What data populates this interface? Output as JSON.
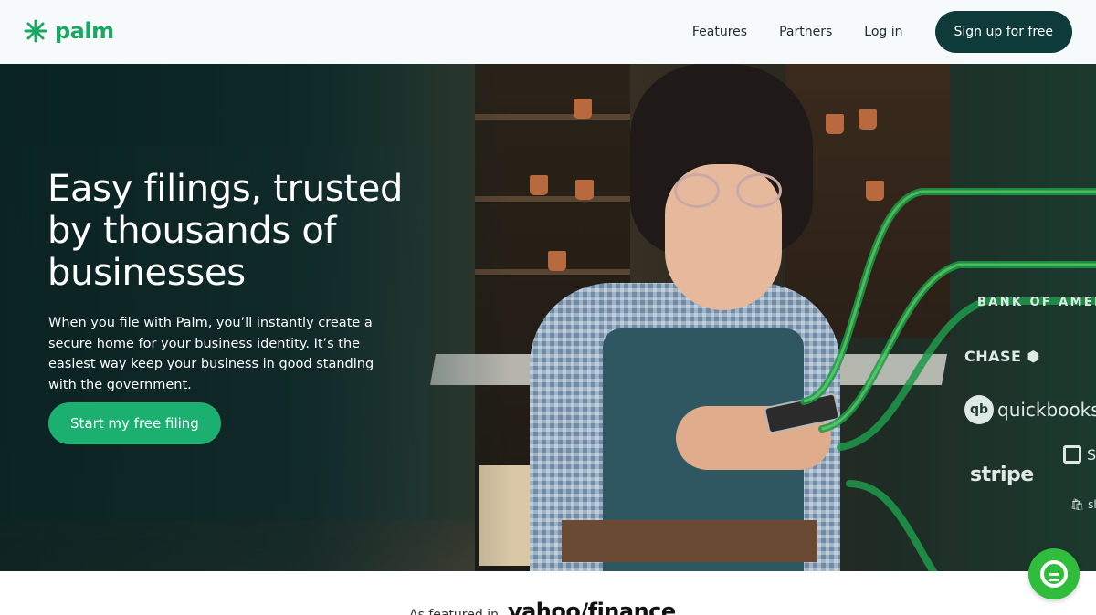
{
  "brand": {
    "name": "palm",
    "accent": "#1aa864"
  },
  "nav": {
    "links": [
      "Features",
      "Partners",
      "Log in"
    ],
    "signup_label": "Sign up for free"
  },
  "hero": {
    "headline": "Easy filings, trusted by thousands of businesses",
    "subcopy": "When you file with Palm, you’ll instantly create a secure home for your business identity. It’s the easiest way keep your business in good standing with the government.",
    "cta_label": "Start my free filing",
    "partners": {
      "boa": "BANK OF AMERIC",
      "chase": "CHASE",
      "quickbooks": "quickbooks",
      "quickbooks_mark": "qb",
      "stripe": "stripe",
      "square": "S",
      "shopify": "sl"
    }
  },
  "featured": {
    "label": "As featured in",
    "logo": "yahoo/finance"
  },
  "colors": {
    "header_bg": "#f7fafa",
    "signup_bg": "#0f3a3a",
    "cta_bg": "#1cb070",
    "chat_bg": "#2fbd3b"
  },
  "icons": {
    "logo": "palm-asterisk-icon",
    "chat": "chat-icon"
  }
}
